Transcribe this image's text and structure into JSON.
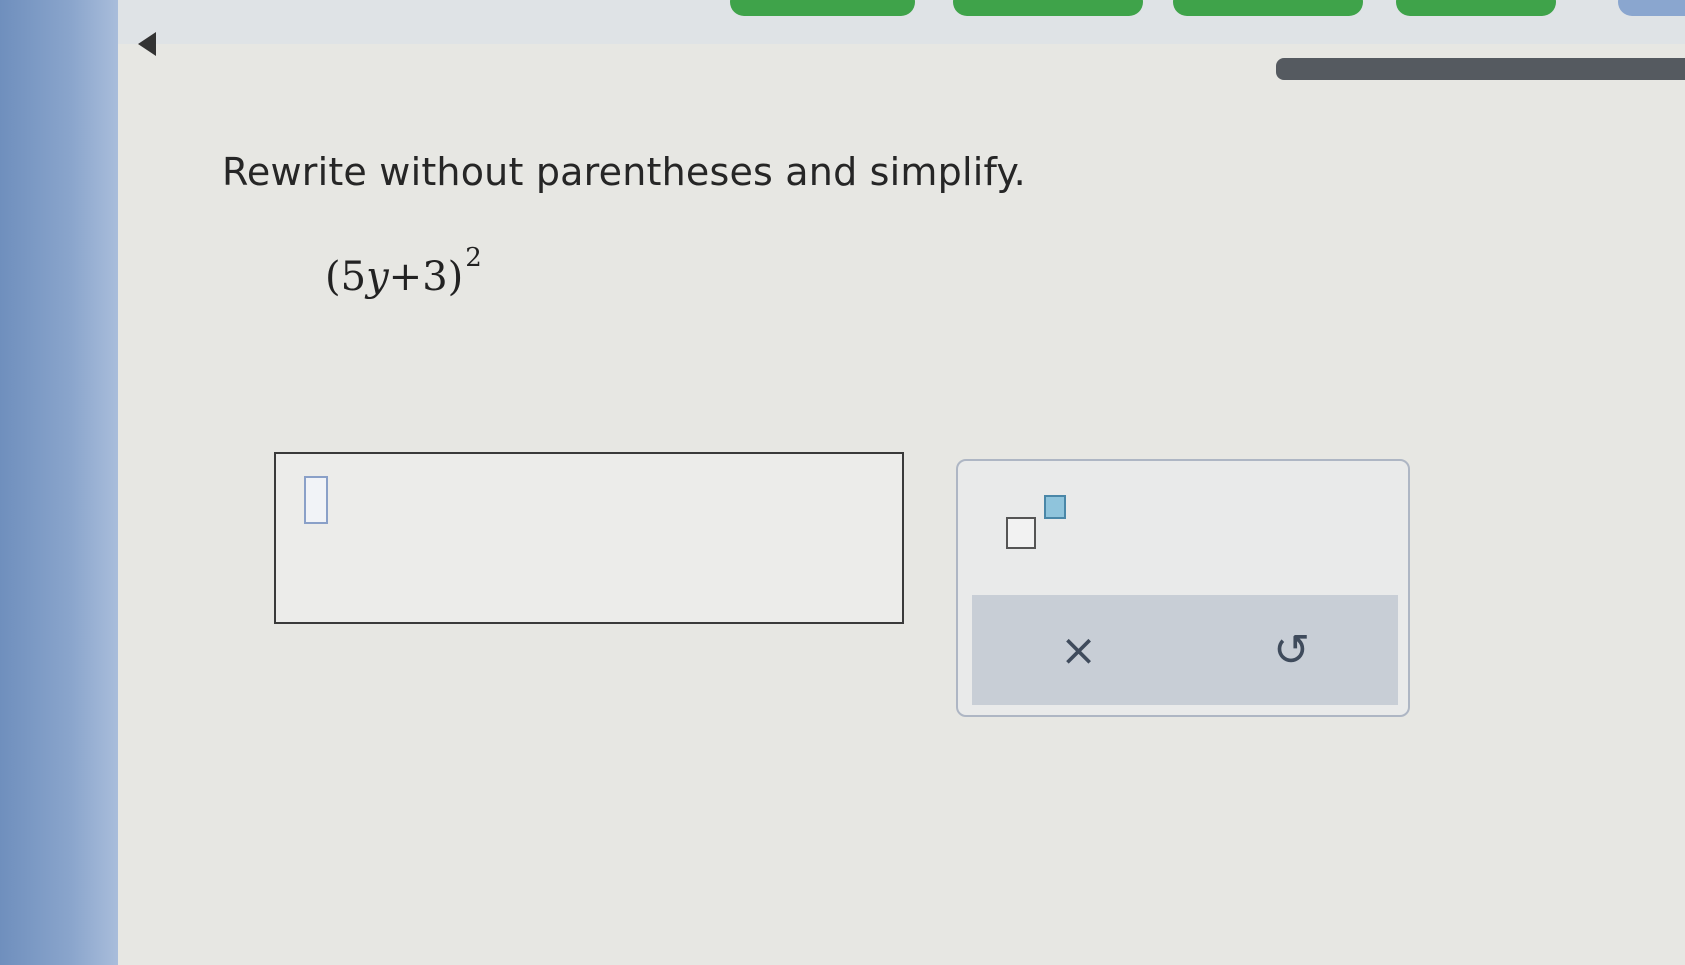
{
  "header": {
    "back_icon": "triangle-left-icon",
    "progress_colors": {
      "complete": "#3fa34a",
      "current": "#8aa6cf"
    }
  },
  "question": {
    "instruction": "Rewrite without parentheses and simplify.",
    "expression": {
      "open": "(",
      "coefficient": "5",
      "variable": "y",
      "operator": "+",
      "constant": "3",
      "close": ")",
      "exponent": "2"
    }
  },
  "answer": {
    "value": ""
  },
  "toolbox": {
    "exponent_icon": "superscript-template-icon",
    "clear_label": "×",
    "undo_label": "↺"
  }
}
